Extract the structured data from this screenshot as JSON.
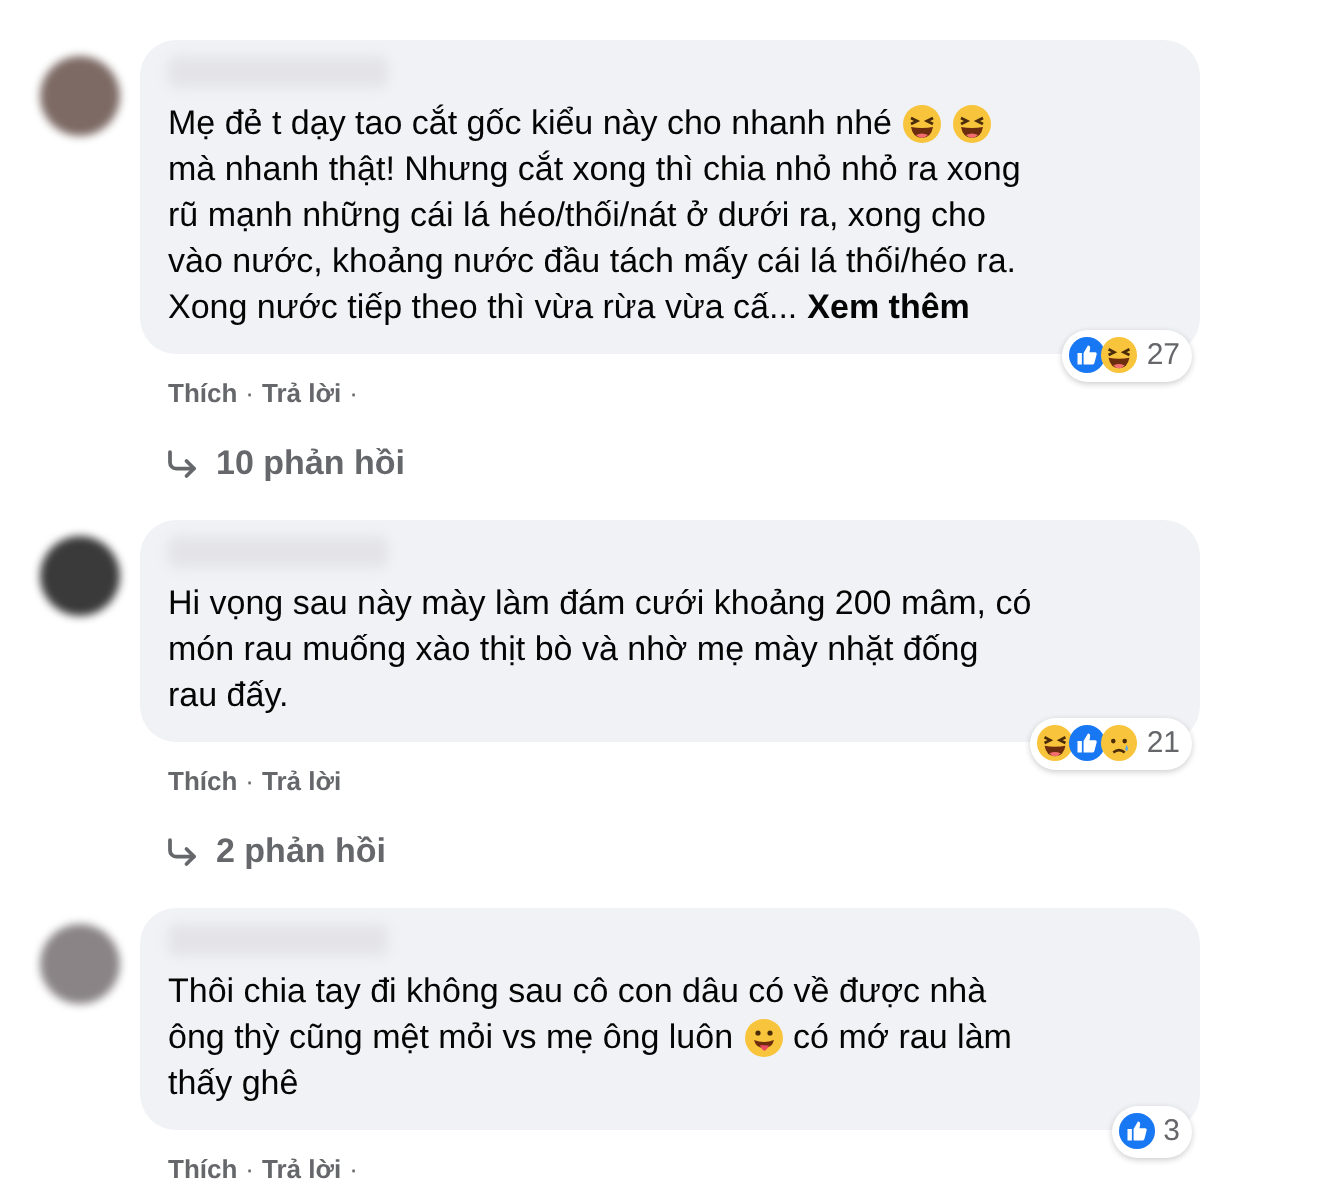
{
  "comments": [
    {
      "lines": [
        [
          {
            "kind": "text",
            "text": "Mẹ đẻ t dạy tao cắt gốc kiểu này cho nhanh nhé"
          },
          {
            "kind": "laugh_emoji"
          },
          {
            "kind": "laugh_emoji"
          }
        ],
        [
          {
            "kind": "text",
            "text": "mà nhanh thật! Nhưng cắt xong thì chia nhỏ nhỏ ra xong"
          }
        ],
        [
          {
            "kind": "text",
            "text": "rũ mạnh những cái lá héo/thối/nát ở dưới ra, xong cho"
          }
        ],
        [
          {
            "kind": "text",
            "text": "vào nước, khoảng nước đầu tách mấy cái lá thối/héo ra."
          }
        ],
        [
          {
            "kind": "text",
            "text": "Xong nước tiếp theo thì vừa rừa vừa cấ..."
          },
          {
            "kind": "link",
            "text": "Xem thêm"
          }
        ]
      ],
      "actions": [
        {
          "kind": "link",
          "label": "Thích"
        },
        {
          "kind": "dot",
          "label": "·"
        },
        {
          "kind": "link",
          "label": "Trả lời"
        },
        {
          "kind": "dot",
          "label": "·"
        }
      ],
      "reactions": [
        {
          "kind": "like"
        },
        {
          "kind": "haha"
        }
      ],
      "reaction_count": "27",
      "replies": "10 phản hồi"
    },
    {
      "lines": [
        [
          {
            "kind": "text",
            "text": "Hi vọng sau này mày làm đám cưới khoảng 200 mâm, có"
          }
        ],
        [
          {
            "kind": "text",
            "text": "món rau muống xào thịt bò và nhờ mẹ mày nhặt đống"
          }
        ],
        [
          {
            "kind": "text",
            "text": "rau đấy."
          }
        ]
      ],
      "actions": [
        {
          "kind": "link",
          "label": "Thích"
        },
        {
          "kind": "dot",
          "label": "·"
        },
        {
          "kind": "link",
          "label": "Trả lời"
        }
      ],
      "reactions": [
        {
          "kind": "haha"
        },
        {
          "kind": "like"
        },
        {
          "kind": "sad"
        }
      ],
      "reaction_count": "21",
      "replies": "2 phản hồi"
    },
    {
      "lines": [
        [
          {
            "kind": "text",
            "text": "Thôi chia tay đi không sau cô con dâu có về được nhà"
          }
        ],
        [
          {
            "kind": "text",
            "text": "ông thỳ cũng mệt mỏi vs mẹ ông luôn"
          },
          {
            "kind": "tongue_emoji"
          },
          {
            "kind": "text",
            "text": "có mớ rau làm"
          }
        ],
        [
          {
            "kind": "text",
            "text": "thấy ghê"
          }
        ]
      ],
      "actions": [
        {
          "kind": "link",
          "label": "Thích"
        },
        {
          "kind": "dot",
          "label": "·"
        },
        {
          "kind": "link",
          "label": "Trả lời"
        },
        {
          "kind": "dot",
          "label": "·"
        }
      ],
      "reactions": [
        {
          "kind": "like"
        }
      ],
      "reaction_count": "3"
    }
  ]
}
